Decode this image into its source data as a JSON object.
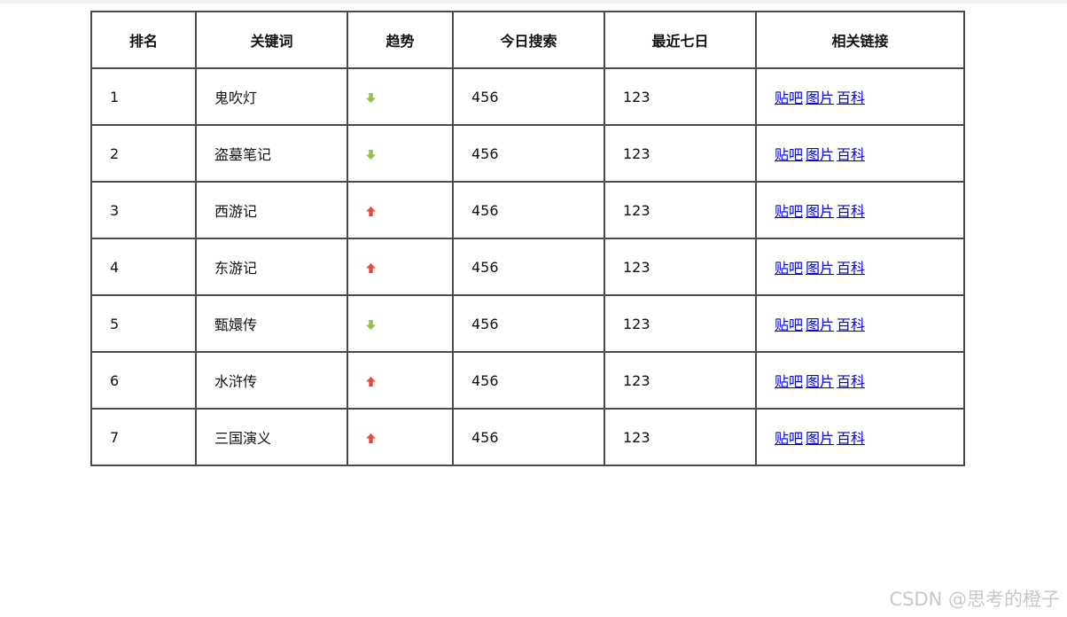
{
  "table": {
    "headers": [
      "排名",
      "关键词",
      "趋势",
      "今日搜索",
      "最近七日",
      "相关链接"
    ],
    "rows": [
      {
        "rank": "1",
        "keyword": "鬼吹灯",
        "trend": "down",
        "today": "456",
        "week": "123",
        "links": [
          "贴吧",
          "图片",
          "百科"
        ]
      },
      {
        "rank": "2",
        "keyword": "盗墓笔记",
        "trend": "down",
        "today": "456",
        "week": "123",
        "links": [
          "贴吧",
          "图片",
          "百科"
        ]
      },
      {
        "rank": "3",
        "keyword": "西游记",
        "trend": "up",
        "today": "456",
        "week": "123",
        "links": [
          "贴吧",
          "图片",
          "百科"
        ]
      },
      {
        "rank": "4",
        "keyword": "东游记",
        "trend": "up",
        "today": "456",
        "week": "123",
        "links": [
          "贴吧",
          "图片",
          "百科"
        ]
      },
      {
        "rank": "5",
        "keyword": "甄嬛传",
        "trend": "down",
        "today": "456",
        "week": "123",
        "links": [
          "贴吧",
          "图片",
          "百科"
        ]
      },
      {
        "rank": "6",
        "keyword": "水浒传",
        "trend": "up",
        "today": "456",
        "week": "123",
        "links": [
          "贴吧",
          "图片",
          "百科"
        ]
      },
      {
        "rank": "7",
        "keyword": "三国演义",
        "trend": "up",
        "today": "456",
        "week": "123",
        "links": [
          "贴吧",
          "图片",
          "百科"
        ]
      }
    ]
  },
  "colors": {
    "trend_up": "#e8453c",
    "trend_down": "#8cc63f",
    "link": "#0000ee",
    "border": "#4a4a4a"
  },
  "icons": {
    "up": "arrow-up-icon",
    "down": "arrow-down-icon"
  },
  "watermark": "CSDN @思考的橙子"
}
